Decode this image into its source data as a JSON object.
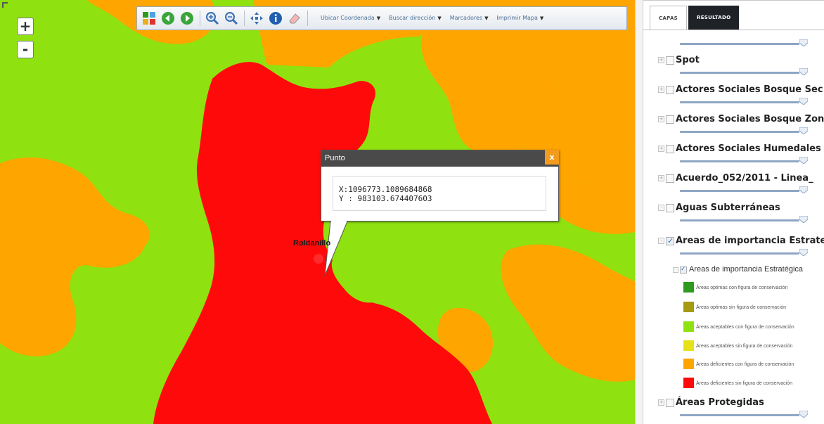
{
  "map": {
    "zoom_in_label": "+",
    "zoom_out_label": "-",
    "toolbar": {
      "menus": [
        {
          "label": "Ubicar Coordenada"
        },
        {
          "label": "Buscar dirección"
        },
        {
          "label": "Marcadores"
        },
        {
          "label": "Imprimir Mapa"
        }
      ],
      "menu_arrow": "▼"
    },
    "popup": {
      "title": "Punto",
      "close_label": "x",
      "x_label": "X:1096773.1089684868",
      "y_label": "Y : 983103.674407603"
    },
    "place_label": "Roldanillo",
    "colors": {
      "optimal_with": "#2e9b1e",
      "optimal_without": "#a59a12",
      "acceptable_with": "#8fe20f",
      "acceptable_without": "#e6e21a",
      "deficient_with": "#ffa500",
      "deficient_without": "#ff0a0a"
    }
  },
  "panel": {
    "tabs": [
      {
        "label": "CAPAS",
        "active": true
      },
      {
        "label": "RESULTADO",
        "active": false
      }
    ],
    "layers": [
      {
        "name": "Spot",
        "checked": false
      },
      {
        "name": "Actores Sociales Bosque Sec",
        "checked": false
      },
      {
        "name": "Actores Sociales Bosque Zon",
        "checked": false
      },
      {
        "name": "Actores Sociales Humedales",
        "checked": false
      },
      {
        "name": "Acuerdo_052/2011 - Linea_",
        "checked": false
      },
      {
        "name": "Aguas Subterráneas",
        "checked": false
      },
      {
        "name": "Areas de importancia Estrate",
        "checked": true
      },
      {
        "name": "Áreas Protegidas",
        "checked": false
      }
    ],
    "sublayer": {
      "name": "Areas de importancia Estratégica",
      "checked": true
    },
    "legend": [
      {
        "label": "Áreas optimas con figura de conservación",
        "color": "#2e9b1e"
      },
      {
        "label": "Áreas optimas sin figura de conservación",
        "color": "#a59a12"
      },
      {
        "label": "Áreas aceptables con figura de conservación",
        "color": "#8fe20f"
      },
      {
        "label": "Áreas aceptables sin figura de conservación",
        "color": "#e6e21a"
      },
      {
        "label": "Áreas deficientes con figura de conservación",
        "color": "#ffa500"
      },
      {
        "label": "Áreas deficientes sin figura de conservación",
        "color": "#ff0a0a"
      }
    ]
  }
}
